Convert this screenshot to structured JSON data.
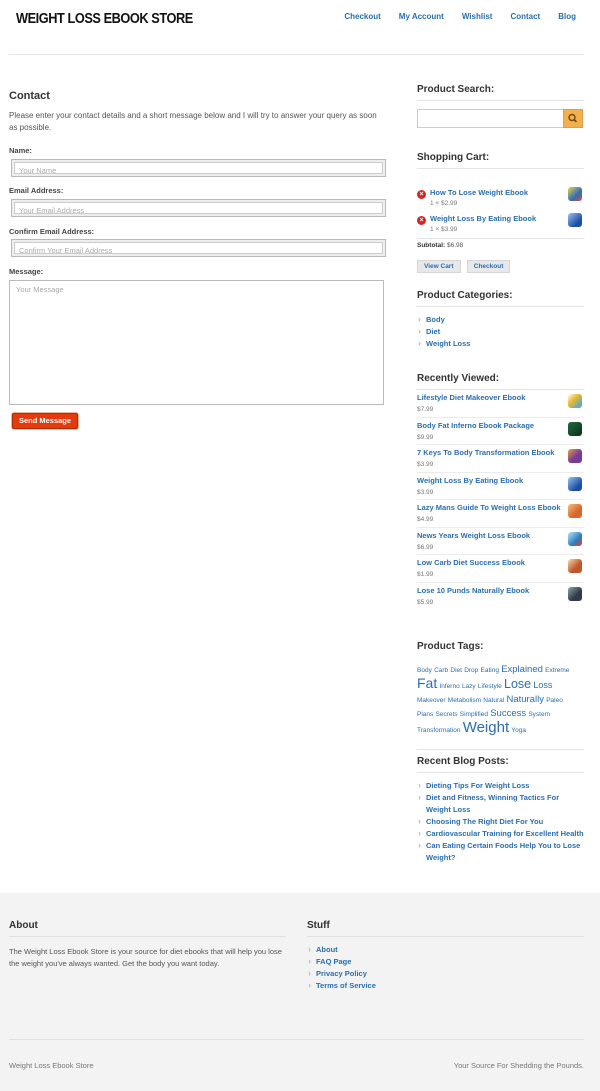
{
  "header": {
    "logo": "WEIGHT LOSS EBOOK STORE",
    "nav": [
      "Checkout",
      "My Account",
      "Wishlist",
      "Contact",
      "Blog"
    ]
  },
  "contact": {
    "title": "Contact",
    "intro": "Please enter your contact details and a short message below and I will try to answer your query as soon as possible.",
    "name_label": "Name:",
    "name_placeholder": "Your Name",
    "email_label": "Email Address:",
    "email_placeholder": "Your Email Address",
    "confirm_label": "Confirm Email Address:",
    "confirm_placeholder": "Confirm Your Email Address",
    "message_label": "Message:",
    "message_placeholder": "Your Message",
    "send_label": "Send Message"
  },
  "sidebar": {
    "search_title": "Product Search:",
    "cart_title": "Shopping Cart:",
    "cart_items": [
      {
        "title": "How To Lose Weight Ebook",
        "qty": "1 × $2.99",
        "color": "#2b6fb5"
      },
      {
        "title": "Weight Loss By Eating Ebook",
        "qty": "1 × $3.99",
        "color": "#1c4fa3"
      }
    ],
    "subtotal_label": "Subtotal:",
    "subtotal_value": "$6.98",
    "view_cart": "View Cart",
    "checkout": "Checkout",
    "categories_title": "Product Categories:",
    "categories": [
      "Body",
      "Diet",
      "Weight Loss"
    ],
    "recent_title": "Recently Viewed:",
    "recent": [
      {
        "title": "Lifestyle Diet Makeover Ebook",
        "price": "$7.99",
        "color": "#e9b830"
      },
      {
        "title": "Body Fat Inferno Ebook Package",
        "price": "$9.99",
        "color": "#1f6b3c"
      },
      {
        "title": "7 Keys To Body Transformation Ebook",
        "price": "$3.99",
        "color": "#7a3a9a"
      },
      {
        "title": "Weight Loss By Eating Ebook",
        "price": "$3.99",
        "color": "#1c4fa3"
      },
      {
        "title": "Lazy Mans Guide To Weight Loss Ebook",
        "price": "$4.99",
        "color": "#d9662e"
      },
      {
        "title": "News Years Weight Loss Ebook",
        "price": "$6.99",
        "color": "#2a7fc0"
      },
      {
        "title": "Low Carb Diet Success Ebook",
        "price": "$1.99",
        "color": "#c0562a"
      },
      {
        "title": "Lose 10 Punds Naturally Ebook",
        "price": "$5.99",
        "color": "#333a4a"
      }
    ],
    "tags_title": "Product Tags:",
    "tags": [
      {
        "label": "Body",
        "size": 6.5
      },
      {
        "label": "Carb",
        "size": 6.5
      },
      {
        "label": "Diet",
        "size": 6.5
      },
      {
        "label": "Drop",
        "size": 6.5
      },
      {
        "label": "Eating",
        "size": 6.5
      },
      {
        "label": "Explained",
        "size": 9.5
      },
      {
        "label": "Extreme",
        "size": 6.5
      },
      {
        "label": "Fat",
        "size": 14
      },
      {
        "label": "Inferno",
        "size": 6.5
      },
      {
        "label": "Lazy",
        "size": 6.5
      },
      {
        "label": "Lifestyle",
        "size": 6.5
      },
      {
        "label": "Lose",
        "size": 12.5
      },
      {
        "label": "Loss",
        "size": 9
      },
      {
        "label": "Makeover",
        "size": 6.5
      },
      {
        "label": "Metabolism",
        "size": 6.5
      },
      {
        "label": "Natural",
        "size": 6.5
      },
      {
        "label": "Naturally",
        "size": 9.5
      },
      {
        "label": "Paleo",
        "size": 6.5
      },
      {
        "label": "Plans",
        "size": 6.5
      },
      {
        "label": "Secrets",
        "size": 6.5
      },
      {
        "label": "Simplified",
        "size": 6.5
      },
      {
        "label": "Success",
        "size": 9.5
      },
      {
        "label": "System",
        "size": 6.5
      },
      {
        "label": "Transformation",
        "size": 6.5
      },
      {
        "label": "Weight",
        "size": 15
      },
      {
        "label": "Yoga",
        "size": 6.5
      }
    ],
    "blog_title": "Recent Blog Posts:",
    "blog": [
      "Dieting Tips For Weight Loss",
      "Diet and Fitness, Winning Tactics For Weight Loss",
      "Choosing The Right Diet For You",
      "Cardiovascular Training for Excellent Health",
      "Can Eating Certain Foods Help You to Lose Weight?"
    ]
  },
  "footer": {
    "about_title": "About",
    "about_text": "The Weight Loss Ebook Store is your source for diet ebooks that will help you lose the weight you've always wanted. Get the body you want today.",
    "stuff_title": "Stuff",
    "stuff_links": [
      "About",
      "FAQ Page",
      "Privacy Policy",
      "Terms of Service"
    ],
    "copyright": "Weight Loss Ebook Store",
    "tagline": "Your Source For Shedding the Pounds."
  }
}
